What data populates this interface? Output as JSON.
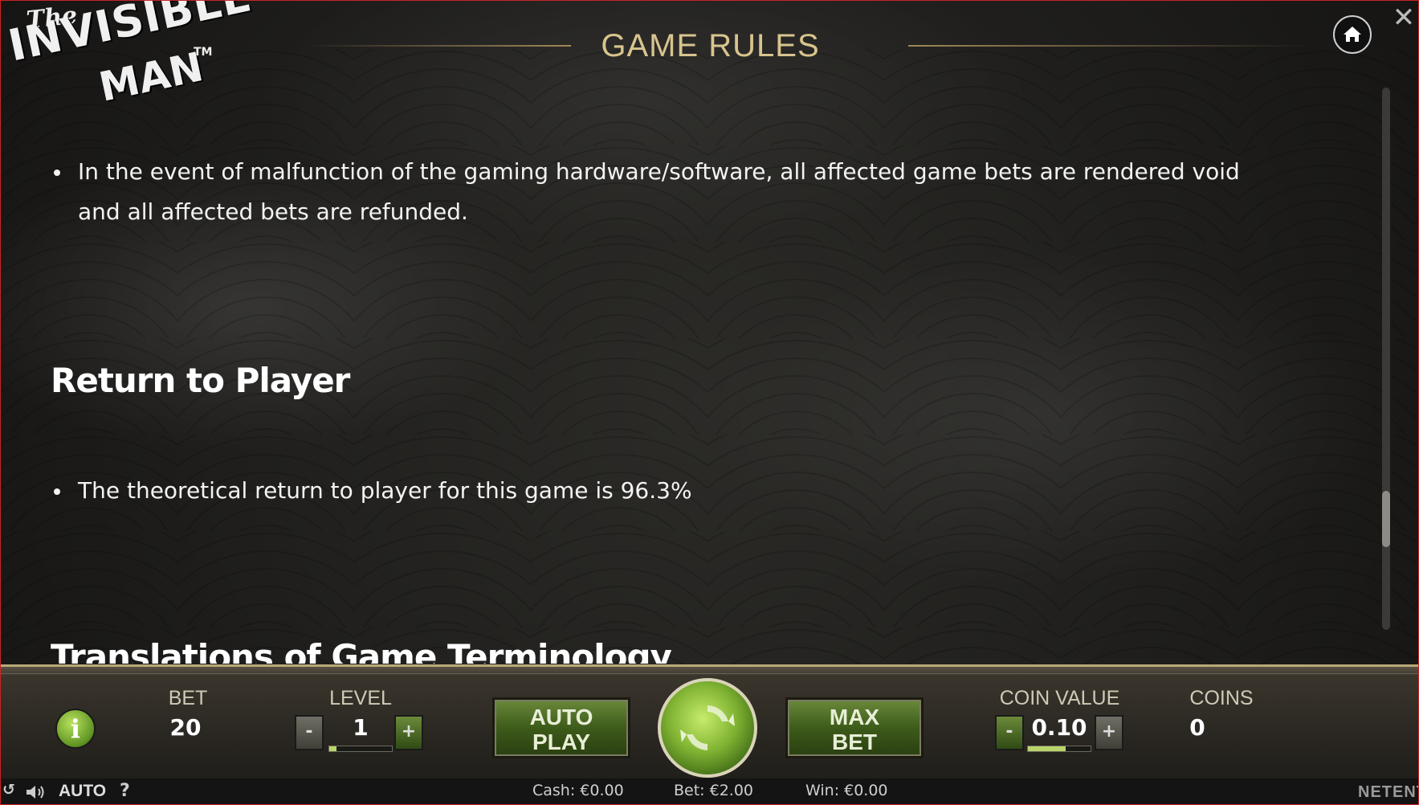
{
  "logo": {
    "line1": "The",
    "line2": "INVISIBLE",
    "line3": "MAN",
    "tm": "TM"
  },
  "header": {
    "title": "GAME RULES",
    "close_glyph": "✕"
  },
  "rules": {
    "items_top": [
      "In the event of malfunction of the gaming hardware/software, all affected game bets are rendered void and all affected bets are refunded."
    ],
    "section_rtp": {
      "heading": "Return to Player",
      "items": [
        "The theoretical return to player for this game is 96.3%"
      ]
    },
    "next_heading": "Translations of Game Terminology"
  },
  "controls": {
    "bet_label": "BET",
    "bet_value": "20",
    "level_label": "LEVEL",
    "level_value": "1",
    "level_minus": "-",
    "level_plus": "+",
    "autoplay_line1": "AUTO",
    "autoplay_line2": "PLAY",
    "maxbet_line1": "MAX",
    "maxbet_line2": "BET",
    "coin_value_label": "COIN VALUE",
    "coin_value": "0.10",
    "coin_minus": "-",
    "coin_plus": "+",
    "coins_label": "COINS",
    "coins_value": "0",
    "info_glyph": "i"
  },
  "status": {
    "auto": "AUTO",
    "help": "?",
    "cash": "Cash: €0.00",
    "bet": "Bet: €2.00",
    "win": "Win: €0.00",
    "brand": "NETENT"
  },
  "icons": [
    "home-icon",
    "close-icon",
    "info-icon",
    "spin-icon",
    "sound-icon",
    "help-icon",
    "refresh-icon"
  ],
  "colors": {
    "title": "#d8c48e",
    "accent_green": "#6a8a3a",
    "bar_border": "#b9a979"
  }
}
